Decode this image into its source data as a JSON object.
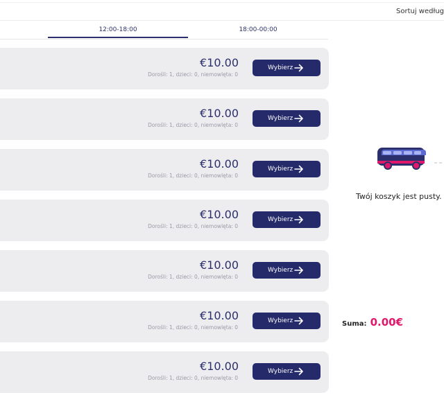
{
  "header": {
    "sort_label": "Sortuj według"
  },
  "tabs": [
    {
      "label": "12:00-18:00",
      "active": true
    },
    {
      "label": "18:00-00:00",
      "active": false
    }
  ],
  "results": [
    {
      "price": "€10.00",
      "passengers": "Dorośli: 1, dzieci: 0, niemowlęta: 0",
      "button": "Wybierz"
    },
    {
      "price": "€10.00",
      "passengers": "Dorośli: 1, dzieci: 0, niemowlęta: 0",
      "button": "Wybierz"
    },
    {
      "price": "€10.00",
      "passengers": "Dorośli: 1, dzieci: 0, niemowlęta: 0",
      "button": "Wybierz"
    },
    {
      "price": "€10.00",
      "passengers": "Dorośli: 1, dzieci: 0, niemowlęta: 0",
      "button": "Wybierz"
    },
    {
      "price": "€10.00",
      "passengers": "Dorośli: 1, dzieci: 0, niemowlęta: 0",
      "button": "Wybierz"
    },
    {
      "price": "€10.00",
      "passengers": "Dorośli: 1, dzieci: 0, niemowlęta: 0",
      "button": "Wybierz"
    },
    {
      "price": "€10.00",
      "passengers": "Dorośli: 1, dzieci: 0, niemowlęta: 0",
      "button": "Wybierz"
    }
  ],
  "cart": {
    "empty_text": "Twój koszyk jest pusty.",
    "sum_label": "Suma:",
    "sum_value": "0.00€"
  },
  "colors": {
    "brand": "#252a6b",
    "accent": "#e0186c",
    "card_bg": "#ededf0"
  },
  "icons": {
    "button_icon": "arrow-right-icon",
    "cart_illustration": "bus-icon"
  }
}
